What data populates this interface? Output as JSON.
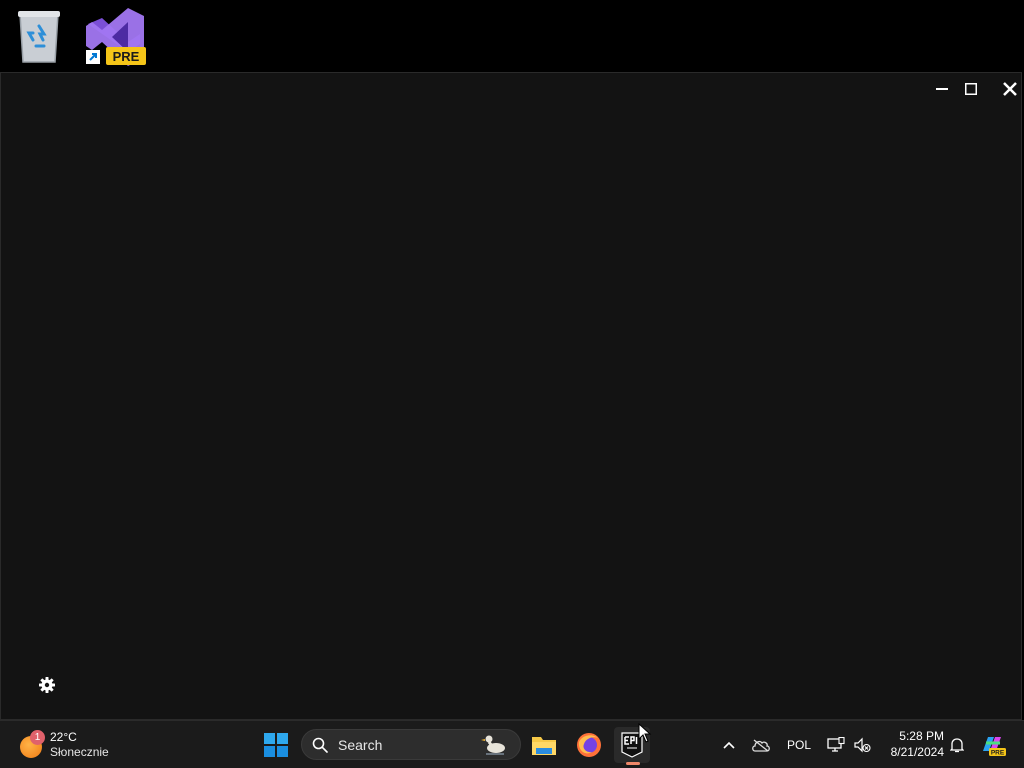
{
  "desktop": {
    "icons": [
      {
        "name": "Recycle Bin"
      },
      {
        "name": "Visual Studio Preview",
        "badge": "PRE"
      }
    ]
  },
  "window": {
    "background": "#131313",
    "controls": {
      "minimize": "minimize",
      "maximize": "maximize",
      "close": "close"
    }
  },
  "taskbar": {
    "weather": {
      "temperature": "22°C",
      "condition": "Słonecznie",
      "badge_count": "1"
    },
    "search": {
      "label": "Search"
    },
    "apps": [
      "start",
      "file-explorer",
      "firefox",
      "epic-games-launcher"
    ],
    "tray": {
      "language": "POL",
      "time": "5:28 PM",
      "date": "8/21/2024"
    }
  },
  "colors": {
    "taskbar": "#1b1b1b",
    "accent_blue": "#0078d4",
    "vs_purple": "#8b5cf6",
    "pre_badge": "#f5c518",
    "running_indicator": "#f0886a"
  }
}
